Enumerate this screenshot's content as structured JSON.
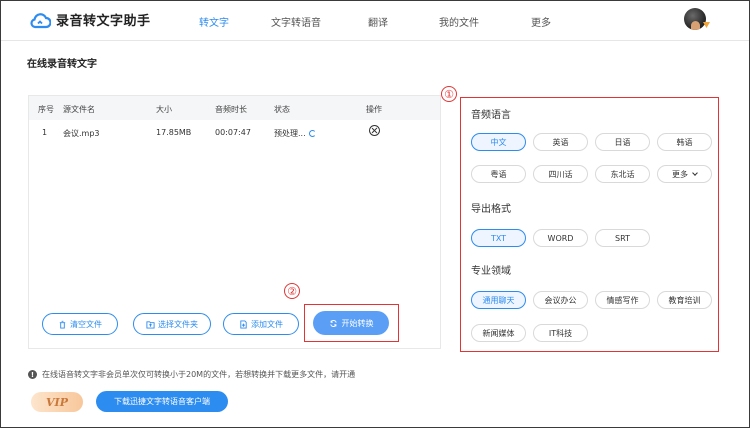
{
  "app": {
    "title": "录音转文字助手",
    "accent_color": "#2d8cf0",
    "highlight_color": "#e23434"
  },
  "nav": {
    "items": [
      {
        "label": "转文字",
        "active": true
      },
      {
        "label": "文字转语音",
        "active": false
      },
      {
        "label": "翻译",
        "active": false
      },
      {
        "label": "我的文件",
        "active": false
      },
      {
        "label": "更多",
        "active": false
      }
    ]
  },
  "page": {
    "title": "在线录音转文字"
  },
  "table": {
    "headers": [
      "序号",
      "源文件名",
      "大小",
      "音频时长",
      "状态",
      "操作"
    ],
    "rows": [
      {
        "index": "1",
        "name": "会议.mp3",
        "size": "17.85MB",
        "duration": "00:07:47",
        "status": "预处理..."
      }
    ]
  },
  "actions": {
    "clear": "清空文件",
    "select_folder": "选择文件夹",
    "add_file": "添加文件",
    "start": "开始转换"
  },
  "annotations": {
    "marker_1": "①",
    "marker_2": "②"
  },
  "options": {
    "language": {
      "title": "音频语言",
      "items": [
        "中文",
        "英语",
        "日语",
        "韩语",
        "粤语",
        "四川话",
        "东北话",
        "更多"
      ],
      "selected": "中文"
    },
    "format": {
      "title": "导出格式",
      "items": [
        "TXT",
        "WORD",
        "SRT"
      ],
      "selected": "TXT"
    },
    "domain": {
      "title": "专业领域",
      "items": [
        "通用聊天",
        "会议办公",
        "情感写作",
        "教育培训",
        "新闻媒体",
        "IT科技"
      ],
      "selected": "通用聊天"
    }
  },
  "footer": {
    "notice": "在线语音转文字非会员单次仅可转换小于20M的文件，若想转换并下载更多文件，请开通",
    "vip": "VIP",
    "download": "下载迅捷文字转语音客户端"
  }
}
